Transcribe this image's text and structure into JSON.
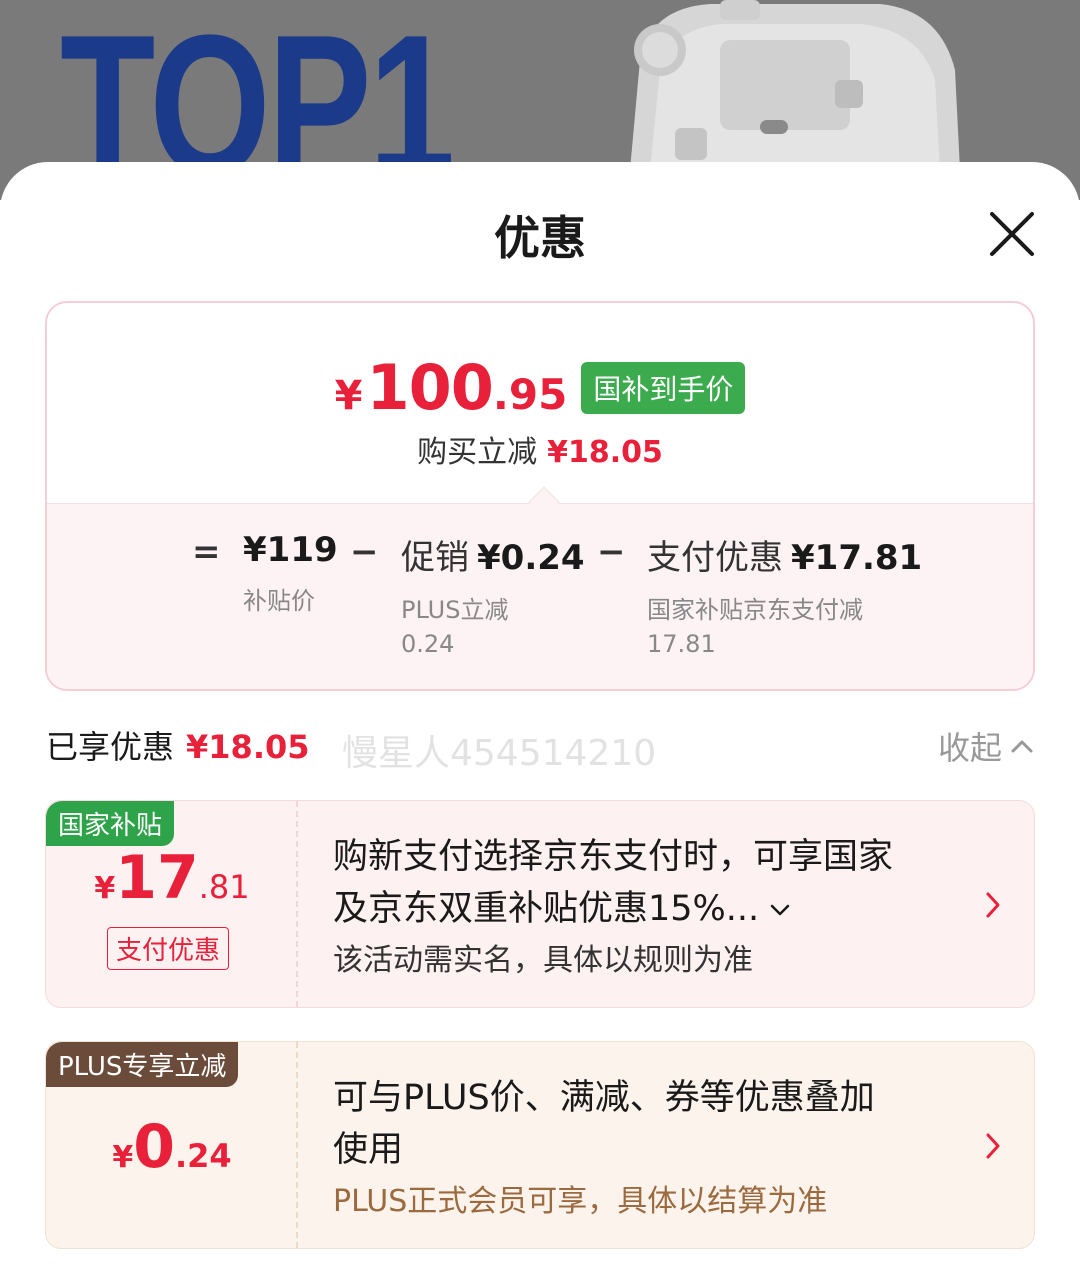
{
  "background": {
    "banner_text": "TOP1"
  },
  "sheet": {
    "title": "优惠",
    "close_icon": "close-icon"
  },
  "price_card": {
    "final_price": {
      "symbol": "¥",
      "integer": "100",
      "decimal": ".95"
    },
    "tag": "国补到手价",
    "save_label": "购买立减",
    "save_amount": "¥18.05",
    "formula": {
      "equals": "=",
      "minus": "−",
      "base": {
        "value": "¥119",
        "sub": "补贴价"
      },
      "promo": {
        "label": "促销",
        "value": "¥0.24",
        "sub_line1": "PLUS立减",
        "sub_line2": "0.24"
      },
      "payment": {
        "label": "支付优惠",
        "value": "¥17.81",
        "sub_line1": "国家补贴京东支付减",
        "sub_line2": "17.81"
      }
    }
  },
  "enjoyed": {
    "label": "已享优惠",
    "amount": "¥18.05",
    "collapse_label": "收起"
  },
  "promos": [
    {
      "tag": "国家补贴",
      "amount": {
        "symbol": "¥",
        "integer": "17",
        "decimal": ".81"
      },
      "badge": "支付优惠",
      "title_line1": "购新支付选择京东支付时，可享国家",
      "title_line2": "及京东双重补贴优惠15%...",
      "subtitle": "该活动需实名，具体以规则为准"
    },
    {
      "tag": "PLUS专享立减",
      "amount": {
        "symbol": "¥",
        "integer": "0",
        "decimal": ".24"
      },
      "title_line1": "可与PLUS价、满减、券等优惠叠加",
      "title_line2": "使用",
      "subtitle": "PLUS正式会员可享，具体以结算为准"
    }
  ],
  "watermark": "慢星人454514210",
  "colors": {
    "price_red": "#e8203a",
    "subsidy_green": "#3cab4e",
    "plus_brown": "#6b4c3b"
  }
}
